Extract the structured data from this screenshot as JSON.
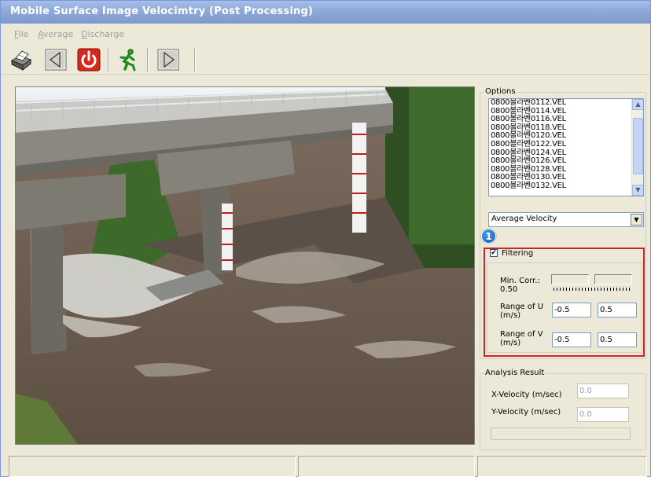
{
  "window": {
    "title": "Mobile Surface Image Velocimtry (Post Processing)"
  },
  "menu": [
    {
      "label": "File",
      "accel": "F"
    },
    {
      "label": "Average",
      "accel": "A"
    },
    {
      "label": "Discharge",
      "accel": "D"
    }
  ],
  "toolbar": {
    "buttons": [
      "printer-icon",
      "previous-frame-icon",
      "power-icon",
      "run-icon",
      "next-frame-icon"
    ]
  },
  "options": {
    "group_label": "Options",
    "files": [
      "0800볼라벤0112.VEL",
      "0800볼라벤0114.VEL",
      "0800볼라벤0116.VEL",
      "0800볼라벤0118.VEL",
      "0800볼라벤0120.VEL",
      "0800볼라벤0122.VEL",
      "0800볼라벤0124.VEL",
      "0800볼라벤0126.VEL",
      "0800볼라벤0128.VEL",
      "0800볼라벤0130.VEL",
      "0800볼라벤0132.VEL"
    ],
    "mode_selected": "Average Velocity",
    "annotation_number": "1"
  },
  "filtering": {
    "label": "Filtering",
    "checked": true,
    "check_glyph": "✔",
    "min_corr_label": "Min. Corr.:",
    "min_corr_value": "0.50",
    "range_u_label": "Range of U",
    "range_u_unit": "(m/s)",
    "range_u_min": "-0.5",
    "range_u_max": "0.5",
    "range_v_label": "Range of V",
    "range_v_unit": "(m/s)",
    "range_v_min": "-0.5",
    "range_v_max": "0.5"
  },
  "result": {
    "group_label": "Analysis Result",
    "x_label": "X-Velocity (m/sec)",
    "x_value": "0.0",
    "y_label": "Y-Velocity (m/sec)",
    "y_value": "0.0"
  },
  "colors": {
    "highlight_box": "#d0202a",
    "badge": "#0a58b8"
  }
}
